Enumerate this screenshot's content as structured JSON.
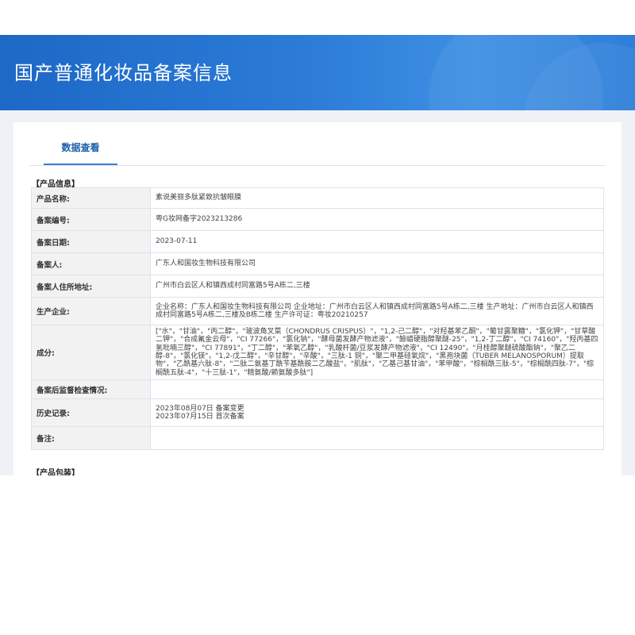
{
  "header": {
    "title": "国产普通化妆品备案信息"
  },
  "tabs": [
    {
      "label": "数据查看"
    }
  ],
  "sections": {
    "product_info": "【产品信息】",
    "product_packaging": "【产品包装】"
  },
  "rows": [
    {
      "label": "产品名称:",
      "value": "素说美丽多肽紧致抗皱眼膜"
    },
    {
      "label": "备案编号:",
      "value": "粤G妆网备字2023213286"
    },
    {
      "label": "备案日期:",
      "value": "2023-07-11"
    },
    {
      "label": "备案人:",
      "value": "广东人和国妆生物科技有限公司"
    },
    {
      "label": "备案人住所地址:",
      "value": "广州市白云区人和镇西成村同富路5号A栋二,三楼"
    },
    {
      "label": "生产企业:",
      "value": "企业名称：广东人和国妆生物科技有限公司 企业地址：广州市白云区人和镇西成村同富路5号A栋二,三楼 生产地址：广州市白云区人和镇西成村同富路5号A栋二,三楼及B栋二楼 生产许可证：粤妆20210257"
    },
    {
      "label": "成分:",
      "value": "[\"水\"，\"甘油\"，\"丙二醇\"，\"玻波角叉菜（CHONDRUS CRISPUS）\"，\"1,2-己二醇\"，\"对羟基苯乙酮\"，\"葡甘露聚糖\"，\"氯化钾\"，\"甘草酸二钾\"，\"合成氟金云母\"，\"CI 77266\"，\"氯化钠\"，\"酵母菌发酵产物滤液\"，\"鲸蜡硬脂醇聚醚-25\"，\"1,2-丁二醇\"，\"CI 74160\"，\"羟丙基四氢吡喃三醇\"，\"CI 77891\"，\"丁二醇\"，\"苯氧乙醇\"，\"乳酸杆菌/豆浆发酵产物滤液\"，\"CI 12490\"，\"月桂醇聚醚硫酸酯钠\"，\"聚乙二醇-8\"，\"氯化镁\"，\"1,2-戊二醇\"，\"辛甘醇\"，\"辛酸\"，\"三肽-1 铜\"，\"聚二甲基硅氧烷\"，\"黑孢块菌（TUBER MELANOSPORUM）提取物\"，\"乙酰基六肽-8\"，\"二肽二氨基丁酰苄基酰胺二乙酸盐\"，\"肌肽\"，\"乙基己基甘油\"，\"苯甲酸\"，\"棕榈酰三肽-5\"，\"棕榈酰四肽-7\"，\"棕榈酰五肽-4\"，\"十三肽-1\"，\"精氨酸/赖氨酸多肽\"]"
    },
    {
      "label": "备案后监督检查情况:",
      "value": ""
    },
    {
      "label": "历史记录:",
      "value": [
        "2023年08月07日 备案变更",
        "2023年07月15日 首次备案"
      ]
    },
    {
      "label": "备注:",
      "value": ""
    }
  ]
}
